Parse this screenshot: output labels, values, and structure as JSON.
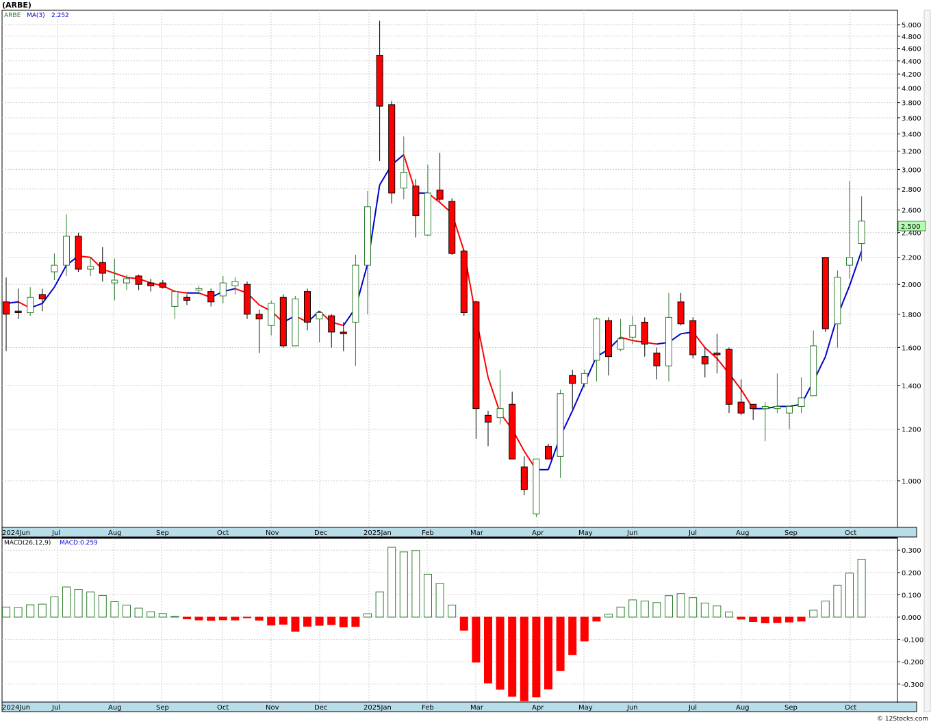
{
  "title": "(ARBE)",
  "footer": "© 12Stocks.com",
  "legend": {
    "symbol": "ARBE",
    "ma_label": "MA(3)",
    "ma_value": "2.252",
    "macd_label": "MACD(26,12,9)",
    "macd_value": "MACD:0.259"
  },
  "colors": {
    "up_candle": "#2e7d2e",
    "down_candle": "#ff0000",
    "ma_up": "#0000cc",
    "ma_down": "#ff0000",
    "axis_strip": "#b8dde8",
    "last_price_bg": "#b0ffb0"
  },
  "chart_data": [
    {
      "type": "candlestick",
      "scale": "log",
      "ylim": [
        0.87,
        5.2
      ],
      "y_ticks": [
        "1.000",
        "1.200",
        "1.400",
        "1.600",
        "1.800",
        "2.000",
        "2.200",
        "2.400",
        "2.600",
        "2.800",
        "3.000",
        "3.200",
        "3.400",
        "3.600",
        "3.800",
        "4.000",
        "4.200",
        "4.400",
        "4.600",
        "4.800",
        "5.000"
      ],
      "x_labels": [
        "2024Jun",
        "Jul",
        "Aug",
        "Sep",
        "Oct",
        "Nov",
        "Dec",
        "2025Jan",
        "Feb",
        "Mar",
        "Apr",
        "May",
        "Jun",
        "Jul",
        "Aug",
        "Sep",
        "Oct"
      ],
      "last_price": "2.500",
      "candles": [
        {
          "o": 1.88,
          "h": 2.05,
          "l": 1.58,
          "c": 1.8
        },
        {
          "o": 1.82,
          "h": 1.97,
          "l": 1.77,
          "c": 1.81
        },
        {
          "o": 1.81,
          "h": 1.98,
          "l": 1.79,
          "c": 1.91
        },
        {
          "o": 1.93,
          "h": 1.97,
          "l": 1.82,
          "c": 1.9
        },
        {
          "o": 2.09,
          "h": 2.23,
          "l": 2.03,
          "c": 2.14
        },
        {
          "o": 2.14,
          "h": 2.56,
          "l": 2.06,
          "c": 2.37
        },
        {
          "o": 2.37,
          "h": 2.4,
          "l": 2.09,
          "c": 2.11
        },
        {
          "o": 2.11,
          "h": 2.2,
          "l": 2.06,
          "c": 2.13
        },
        {
          "o": 2.16,
          "h": 2.28,
          "l": 2.02,
          "c": 2.08
        },
        {
          "o": 2.01,
          "h": 2.19,
          "l": 1.89,
          "c": 2.03
        },
        {
          "o": 2.01,
          "h": 2.07,
          "l": 1.96,
          "c": 2.04
        },
        {
          "o": 2.06,
          "h": 2.07,
          "l": 1.96,
          "c": 2.0
        },
        {
          "o": 2.01,
          "h": 2.04,
          "l": 1.95,
          "c": 1.99
        },
        {
          "o": 2.01,
          "h": 2.03,
          "l": 1.97,
          "c": 1.98
        },
        {
          "o": 1.85,
          "h": 1.96,
          "l": 1.77,
          "c": 1.95
        },
        {
          "o": 1.91,
          "h": 1.93,
          "l": 1.86,
          "c": 1.89
        },
        {
          "o": 1.96,
          "h": 1.99,
          "l": 1.93,
          "c": 1.97
        },
        {
          "o": 1.95,
          "h": 1.97,
          "l": 1.85,
          "c": 1.88
        },
        {
          "o": 1.92,
          "h": 2.06,
          "l": 1.87,
          "c": 2.01
        },
        {
          "o": 1.99,
          "h": 2.05,
          "l": 1.93,
          "c": 2.02
        },
        {
          "o": 2.0,
          "h": 2.02,
          "l": 1.77,
          "c": 1.8
        },
        {
          "o": 1.8,
          "h": 1.83,
          "l": 1.57,
          "c": 1.77
        },
        {
          "o": 1.73,
          "h": 1.89,
          "l": 1.67,
          "c": 1.87
        },
        {
          "o": 1.91,
          "h": 1.93,
          "l": 1.6,
          "c": 1.61
        },
        {
          "o": 1.61,
          "h": 1.92,
          "l": 1.61,
          "c": 1.9
        },
        {
          "o": 1.95,
          "h": 1.97,
          "l": 1.7,
          "c": 1.75
        },
        {
          "o": 1.77,
          "h": 1.81,
          "l": 1.63,
          "c": 1.81
        },
        {
          "o": 1.79,
          "h": 1.8,
          "l": 1.6,
          "c": 1.69
        },
        {
          "o": 1.69,
          "h": 1.75,
          "l": 1.58,
          "c": 1.68
        },
        {
          "o": 1.75,
          "h": 2.22,
          "l": 1.5,
          "c": 2.14
        },
        {
          "o": 2.14,
          "h": 2.78,
          "l": 1.8,
          "c": 2.63
        },
        {
          "o": 4.49,
          "h": 5.07,
          "l": 3.09,
          "c": 3.75
        },
        {
          "o": 3.77,
          "h": 3.82,
          "l": 2.66,
          "c": 2.76
        },
        {
          "o": 2.81,
          "h": 3.37,
          "l": 2.7,
          "c": 2.97
        },
        {
          "o": 2.83,
          "h": 2.9,
          "l": 2.36,
          "c": 2.55
        },
        {
          "o": 2.38,
          "h": 3.05,
          "l": 2.37,
          "c": 2.76
        },
        {
          "o": 2.79,
          "h": 3.18,
          "l": 2.68,
          "c": 2.7
        },
        {
          "o": 2.68,
          "h": 2.71,
          "l": 2.22,
          "c": 2.23
        },
        {
          "o": 2.25,
          "h": 2.26,
          "l": 1.79,
          "c": 1.81
        },
        {
          "o": 1.88,
          "h": 1.89,
          "l": 1.16,
          "c": 1.29
        },
        {
          "o": 1.26,
          "h": 1.28,
          "l": 1.13,
          "c": 1.23
        },
        {
          "o": 1.25,
          "h": 1.48,
          "l": 1.22,
          "c": 1.29
        },
        {
          "o": 1.31,
          "h": 1.37,
          "l": 1.08,
          "c": 1.08
        },
        {
          "o": 1.05,
          "h": 1.09,
          "l": 0.95,
          "c": 0.97
        },
        {
          "o": 0.89,
          "h": 1.04,
          "l": 0.88,
          "c": 1.08
        },
        {
          "o": 1.13,
          "h": 1.14,
          "l": 1.08,
          "c": 1.08
        },
        {
          "o": 1.09,
          "h": 1.38,
          "l": 1.01,
          "c": 1.36
        },
        {
          "o": 1.45,
          "h": 1.48,
          "l": 1.29,
          "c": 1.41
        },
        {
          "o": 1.41,
          "h": 1.48,
          "l": 1.39,
          "c": 1.46
        },
        {
          "o": 1.53,
          "h": 1.78,
          "l": 1.42,
          "c": 1.77
        },
        {
          "o": 1.76,
          "h": 1.78,
          "l": 1.45,
          "c": 1.55
        },
        {
          "o": 1.59,
          "h": 1.77,
          "l": 1.58,
          "c": 1.65
        },
        {
          "o": 1.66,
          "h": 1.79,
          "l": 1.62,
          "c": 1.73
        },
        {
          "o": 1.75,
          "h": 1.78,
          "l": 1.55,
          "c": 1.62
        },
        {
          "o": 1.57,
          "h": 1.6,
          "l": 1.43,
          "c": 1.5
        },
        {
          "o": 1.5,
          "h": 1.94,
          "l": 1.42,
          "c": 1.78
        },
        {
          "o": 1.88,
          "h": 1.94,
          "l": 1.73,
          "c": 1.74
        },
        {
          "o": 1.76,
          "h": 1.78,
          "l": 1.54,
          "c": 1.56
        },
        {
          "o": 1.55,
          "h": 1.6,
          "l": 1.44,
          "c": 1.51
        },
        {
          "o": 1.57,
          "h": 1.68,
          "l": 1.46,
          "c": 1.56
        },
        {
          "o": 1.59,
          "h": 1.6,
          "l": 1.27,
          "c": 1.31
        },
        {
          "o": 1.32,
          "h": 1.43,
          "l": 1.26,
          "c": 1.27
        },
        {
          "o": 1.31,
          "h": 1.31,
          "l": 1.24,
          "c": 1.29
        },
        {
          "o": 1.29,
          "h": 1.32,
          "l": 1.15,
          "c": 1.3
        },
        {
          "o": 1.29,
          "h": 1.46,
          "l": 1.27,
          "c": 1.3
        },
        {
          "o": 1.27,
          "h": 1.3,
          "l": 1.2,
          "c": 1.3
        },
        {
          "o": 1.3,
          "h": 1.44,
          "l": 1.27,
          "c": 1.34
        },
        {
          "o": 1.35,
          "h": 1.7,
          "l": 1.35,
          "c": 1.61
        },
        {
          "o": 2.2,
          "h": 2.2,
          "l": 1.69,
          "c": 1.71
        },
        {
          "o": 1.74,
          "h": 2.1,
          "l": 1.6,
          "c": 2.05
        },
        {
          "o": 2.14,
          "h": 2.88,
          "l": 2.04,
          "c": 2.2
        },
        {
          "o": 2.31,
          "h": 2.73,
          "l": 2.17,
          "c": 2.5
        }
      ],
      "ma3": [
        1.87,
        1.88,
        1.84,
        1.87,
        1.98,
        2.14,
        2.21,
        2.2,
        2.11,
        2.08,
        2.05,
        2.04,
        2.01,
        1.99,
        1.95,
        1.94,
        1.94,
        1.91,
        1.95,
        1.97,
        1.94,
        1.86,
        1.82,
        1.75,
        1.79,
        1.75,
        1.82,
        1.75,
        1.73,
        1.84,
        2.15,
        2.84,
        3.05,
        3.16,
        2.76,
        2.76,
        2.67,
        2.57,
        2.25,
        1.78,
        1.44,
        1.27,
        1.2,
        1.11,
        1.04,
        1.04,
        1.17,
        1.28,
        1.41,
        1.55,
        1.59,
        1.66,
        1.64,
        1.63,
        1.62,
        1.63,
        1.68,
        1.69,
        1.6,
        1.54,
        1.46,
        1.38,
        1.29,
        1.29,
        1.3,
        1.3,
        1.31,
        1.42,
        1.55,
        1.79,
        1.99,
        2.25
      ]
    },
    {
      "type": "bar",
      "name": "MACD(26,12,9)",
      "ylim": [
        -0.37,
        0.33
      ],
      "y_ticks": [
        "0.300",
        "0.200",
        "0.100",
        "0.000",
        "-0.100",
        "-0.200",
        "-0.300"
      ],
      "x_labels": [
        "2024Jun",
        "Jul",
        "Aug",
        "Sep",
        "Oct",
        "Nov",
        "Dec",
        "2025Jan",
        "Feb",
        "Mar",
        "Apr",
        "May",
        "Jun",
        "Jul",
        "Aug",
        "Sep",
        "Oct"
      ],
      "values": [
        0.045,
        0.043,
        0.055,
        0.058,
        0.091,
        0.135,
        0.124,
        0.113,
        0.097,
        0.069,
        0.054,
        0.04,
        0.024,
        0.016,
        0.003,
        -0.008,
        -0.013,
        -0.015,
        -0.012,
        -0.013,
        -0.003,
        -0.014,
        -0.036,
        -0.032,
        -0.064,
        -0.041,
        -0.037,
        -0.034,
        -0.044,
        -0.042,
        0.015,
        0.113,
        0.313,
        0.292,
        0.298,
        0.192,
        0.151,
        0.054,
        -0.059,
        -0.202,
        -0.295,
        -0.323,
        -0.355,
        -0.375,
        -0.358,
        -0.322,
        -0.24,
        -0.168,
        -0.107,
        -0.018,
        0.013,
        0.045,
        0.077,
        0.072,
        0.065,
        0.096,
        0.105,
        0.087,
        0.063,
        0.05,
        0.023,
        -0.009,
        -0.02,
        -0.026,
        -0.025,
        -0.022,
        -0.018,
        0.031,
        0.072,
        0.143,
        0.197,
        0.259
      ]
    }
  ]
}
